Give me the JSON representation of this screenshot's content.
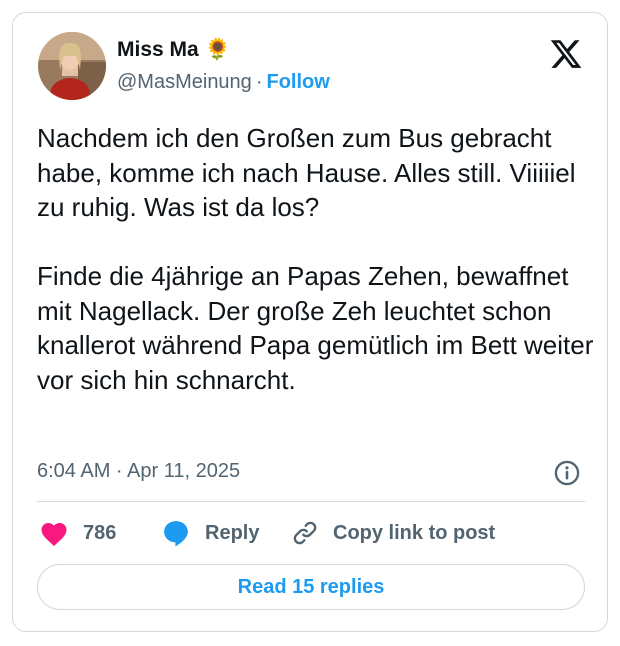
{
  "author": {
    "name": "Miss Ma 🌻",
    "handle": "@MasMeinung",
    "separator": "·",
    "follow_label": "Follow"
  },
  "tweet": {
    "paragraphs": [
      "Nachdem ich den Großen zum Bus gebracht habe, komme ich nach Hause. Alles still. Viiiiiel zu ruhig. Was ist da los?",
      "Finde die 4jährige an Papas Zehen, bewaffnet mit Nagellack. Der große Zeh leuchtet schon knallerot während Papa gemütlich im Bett weiter vor sich hin schnarcht."
    ],
    "timestamp": "6:04 AM · Apr 11, 2025"
  },
  "actions": {
    "like_count": "786",
    "reply_label": "Reply",
    "copy_label": "Copy link to post"
  },
  "footer": {
    "read_replies_label": "Read 15 replies"
  },
  "icons": {
    "brand": "x-logo-icon",
    "info": "info-icon",
    "like": "heart-icon",
    "reply": "speech-bubble-icon",
    "copy": "link-icon"
  },
  "colors": {
    "accent": "#1d9bf0",
    "like": "#f91880",
    "text": "#0f1419",
    "muted": "#536471",
    "border": "#cfd9de"
  }
}
